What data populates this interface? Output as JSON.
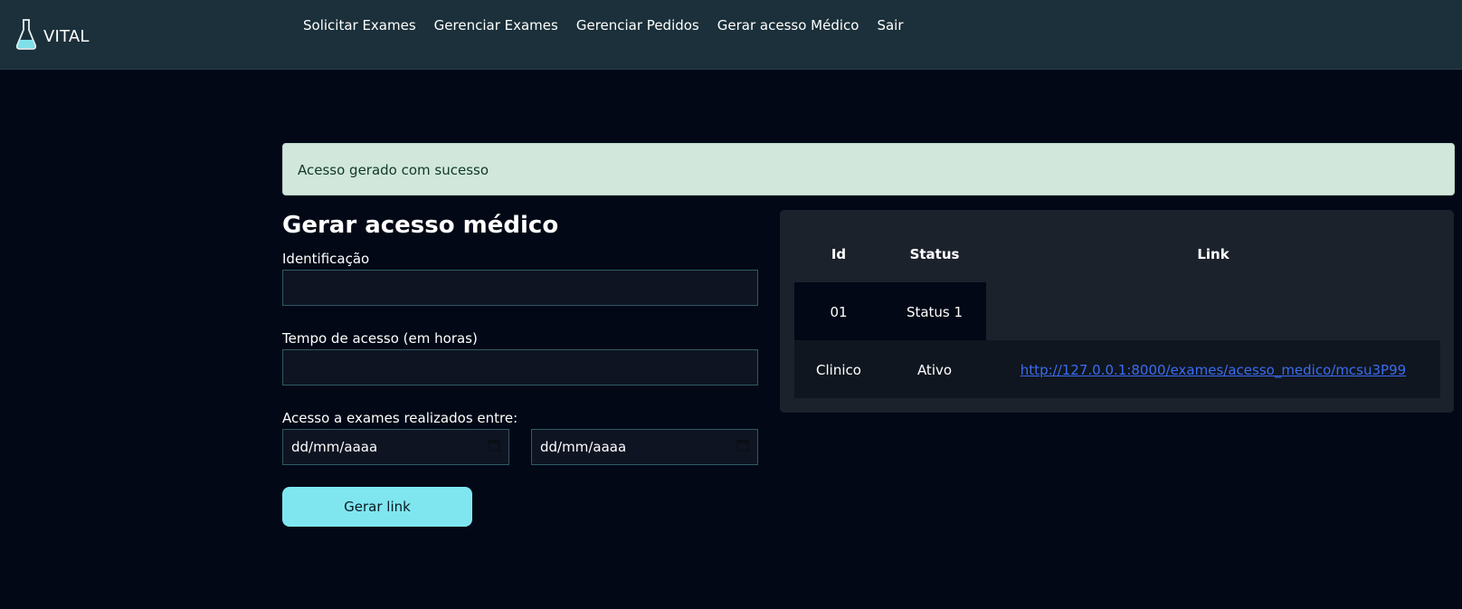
{
  "brand": {
    "name": "VITAL",
    "icon": "flask-icon"
  },
  "nav": {
    "items": [
      {
        "label": "Solicitar Exames"
      },
      {
        "label": "Gerenciar Exames"
      },
      {
        "label": "Gerenciar Pedidos"
      },
      {
        "label": "Gerar acesso Médico"
      },
      {
        "label": "Sair"
      }
    ]
  },
  "alert": {
    "message": "Acesso gerado com sucesso"
  },
  "form": {
    "title": "Gerar acesso médico",
    "identificacao": {
      "label": "Identificação",
      "value": ""
    },
    "tempo": {
      "label": "Tempo de acesso (em horas)",
      "value": ""
    },
    "periodo": {
      "label": "Acesso a exames realizados entre:",
      "start_placeholder": "dd/mm/aaaa",
      "end_placeholder": "dd/mm/aaaa"
    },
    "submit_label": "Gerar link"
  },
  "table": {
    "headers": [
      "Id",
      "Status",
      "Link"
    ],
    "rows": [
      [
        "01",
        "Status 1",
        ""
      ],
      [
        "Clinico",
        "Ativo",
        "http://127.0.0.1:8000/exames/acesso_medico/mcsu3P99"
      ]
    ]
  },
  "colors": {
    "background": "#020816",
    "navbar": "#1b303a",
    "alert_bg": "#d2e7dc",
    "button": "#7fe6f0",
    "link": "#3b6cf0"
  }
}
